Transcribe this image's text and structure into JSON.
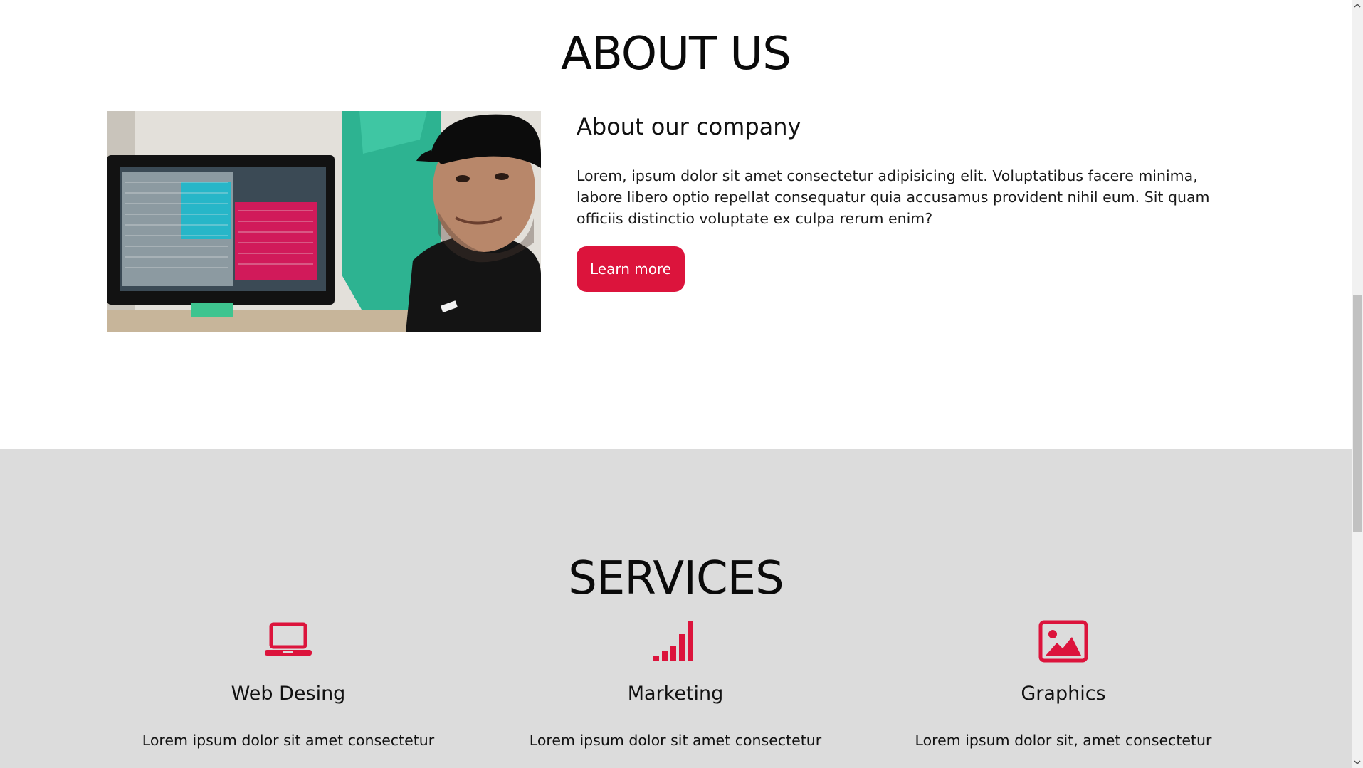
{
  "about": {
    "title": "ABOUT US",
    "subtitle": "About our company",
    "body": "Lorem, ipsum dolor sit amet consectetur adipisicing elit. Voluptatibus facere minima, labore libero optio repellat consequatur quia accusamus provident nihil eum. Sit quam officiis distinctio voluptate ex culpa rerum enim?",
    "button_label": "Learn more",
    "photo_icon": "person-at-computer-photo"
  },
  "services": {
    "title": "SERVICES",
    "items": [
      {
        "icon": "laptop-icon",
        "title": "Web Desing",
        "desc": "Lorem ipsum dolor sit amet consectetur"
      },
      {
        "icon": "signal-bars-icon",
        "title": "Marketing",
        "desc": "Lorem ipsum dolor sit amet consectetur"
      },
      {
        "icon": "image-icon",
        "title": "Graphics",
        "desc": "Lorem ipsum dolor sit, amet consectetur"
      }
    ]
  },
  "colors": {
    "accent": "#dc143c",
    "services_bg": "#dcdcdc"
  }
}
